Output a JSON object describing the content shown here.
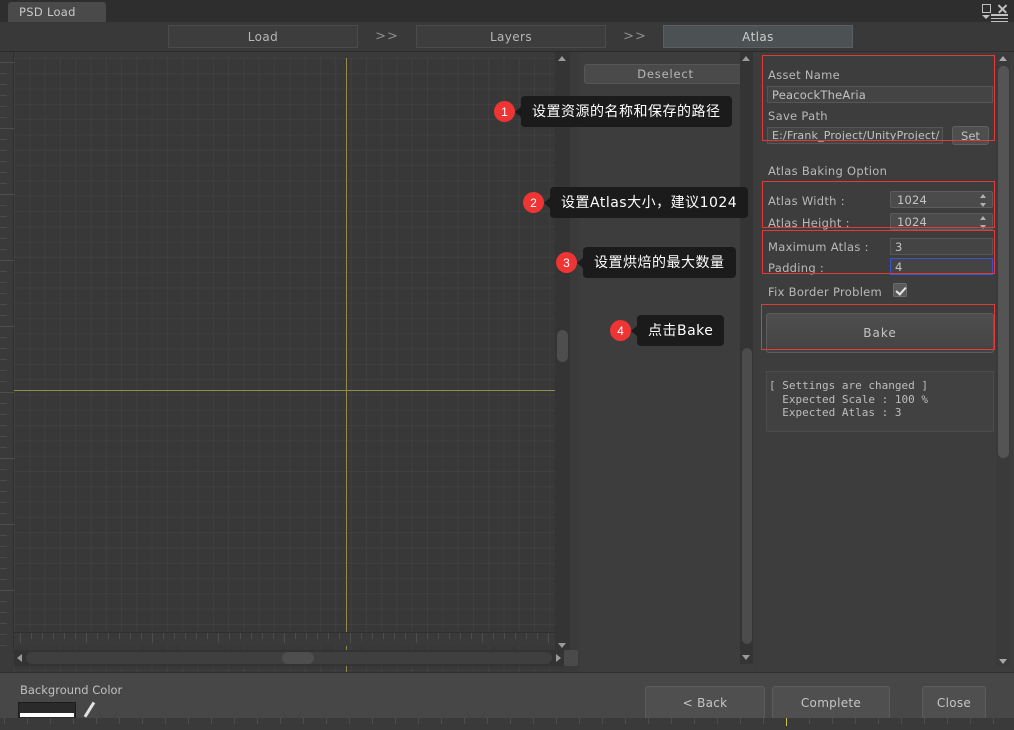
{
  "window": {
    "tab_title": "PSD Load",
    "controls": {
      "maximize": "maximize-icon",
      "close": "close-icon",
      "menu": "menu-icon"
    }
  },
  "stepbar": {
    "steps": [
      {
        "label": "Load",
        "active": false
      },
      {
        "label": "Layers",
        "active": false
      },
      {
        "label": "Atlas",
        "active": true
      }
    ],
    "separator": ">>"
  },
  "viewport": {
    "guides_color": "#8f8c4e",
    "grid": true
  },
  "midpanel": {
    "deselect_label": "Deselect"
  },
  "inspector": {
    "asset_name_label": "Asset Name",
    "asset_name_value": "PeacockTheAria",
    "save_path_label": "Save Path",
    "save_path_value": "E:/Frank_Project/UnityProject/",
    "set_label": "Set",
    "baking_option_label": "Atlas Baking Option",
    "atlas_width_label": "Atlas Width :",
    "atlas_width_value": "1024",
    "atlas_height_label": "Atlas Height :",
    "atlas_height_value": "1024",
    "maximum_atlas_label": "Maximum Atlas :",
    "maximum_atlas_value": "3",
    "padding_label": "Padding :",
    "padding_value": "4",
    "fix_border_label": "Fix Border Problem",
    "fix_border_checked": true,
    "bake_label": "Bake",
    "status": {
      "line1": "[ Settings are changed ]",
      "line2": "  Expected Scale : 100 %",
      "line3": "  Expected Atlas : 3"
    }
  },
  "callouts": [
    {
      "number": "1",
      "text": "设置资源的名称和保存的路径"
    },
    {
      "number": "2",
      "text": "设置Atlas大小，建议1024"
    },
    {
      "number": "3",
      "text": "设置烘焙的最大数量"
    },
    {
      "number": "4",
      "text": "点击Bake"
    }
  ],
  "bottombar": {
    "background_color_label": "Background Color",
    "back_label": "< Back",
    "complete_label": "Complete",
    "close_label": "Close"
  },
  "colors": {
    "accent_red": "#ef3434",
    "highlight_border": "#e03a3a",
    "focus_blue": "#3a55c8",
    "guide_yellow": "#8f8c4e"
  }
}
